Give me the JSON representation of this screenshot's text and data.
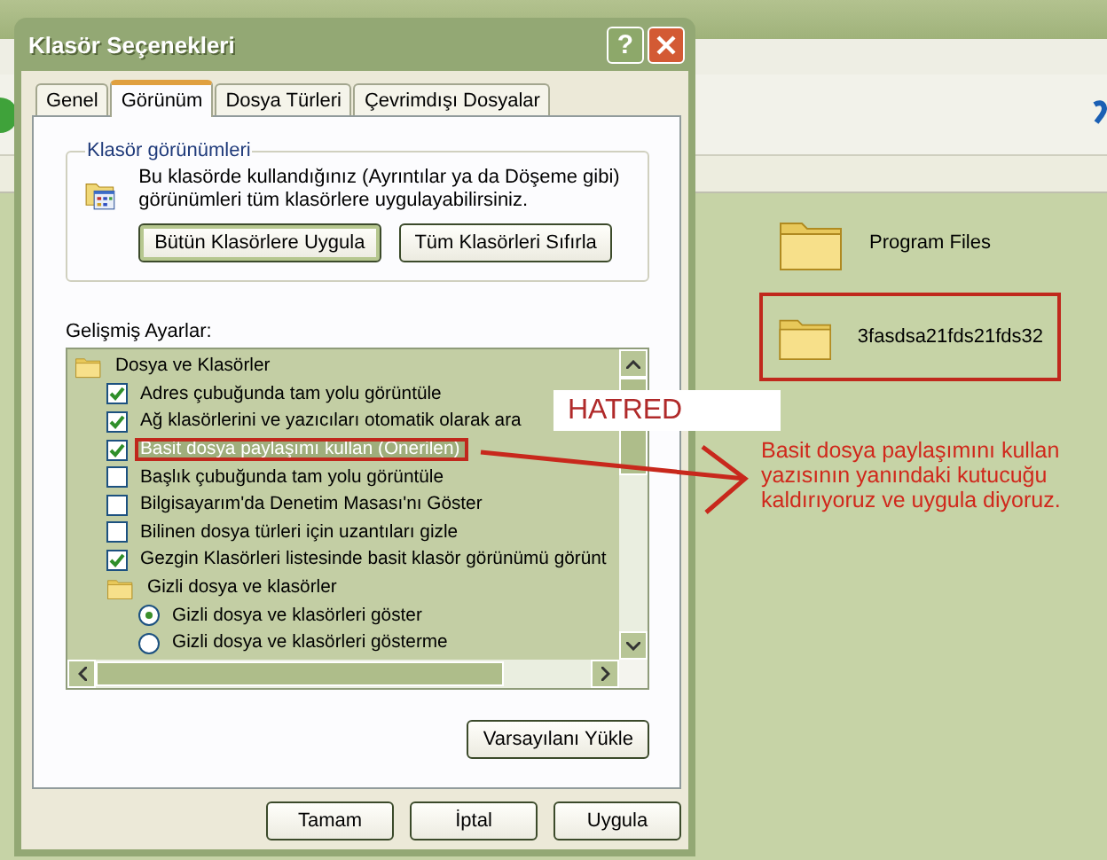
{
  "background_window": {
    "files": [
      {
        "name": "Program Files",
        "highlighted": false
      },
      {
        "name": "3fasdsa21fds21fds32",
        "highlighted": true
      }
    ]
  },
  "dialog": {
    "title": "Klasör Seçenekleri",
    "help": "?",
    "tabs": [
      {
        "label": "Genel",
        "selected": false
      },
      {
        "label": "Görünüm",
        "selected": true
      },
      {
        "label": "Dosya Türleri",
        "selected": false
      },
      {
        "label": "Çevrimdışı Dosyalar",
        "selected": false
      }
    ],
    "views_group": {
      "title": "Klasör görünümleri",
      "description": "Bu klasörde kullandığınız (Ayrıntılar ya da Döşeme gibi) görünümleri tüm klasörlere uygulayabilirsiniz.",
      "buttons": [
        "Bütün Klasörlere Uygula",
        "Tüm Klasörleri Sıfırla"
      ]
    },
    "advanced": {
      "label": "Gelişmiş Ayarlar:",
      "items": [
        {
          "kind": "folder",
          "label": "Dosya ve Klasörler",
          "selected": false,
          "highlighted": false,
          "children": [
            {
              "kind": "checkbox",
              "label": "Adres çubuğunda tam yolu görüntüle",
              "checked": true,
              "selected": false,
              "highlighted": false
            },
            {
              "kind": "checkbox",
              "label": "Ağ klasörlerini ve yazıcıları otomatik olarak ara",
              "checked": true,
              "selected": false,
              "highlighted": false
            },
            {
              "kind": "checkbox",
              "label": "Basit dosya paylaşımı kullan (Önerilen)",
              "checked": true,
              "selected": true,
              "highlighted": true
            },
            {
              "kind": "checkbox",
              "label": "Başlık çubuğunda tam yolu görüntüle",
              "checked": false,
              "selected": false,
              "highlighted": false
            },
            {
              "kind": "checkbox",
              "label": "Bilgisayarım'da Denetim Masası'nı Göster",
              "checked": false,
              "selected": false,
              "highlighted": false
            },
            {
              "kind": "checkbox",
              "label": "Bilinen dosya türleri için uzantıları gizle",
              "checked": false,
              "selected": false,
              "highlighted": false
            },
            {
              "kind": "checkbox",
              "label": "Gezgin Klasörleri listesinde basit klasör görünümü görünt",
              "checked": true,
              "selected": false,
              "highlighted": false
            },
            {
              "kind": "folder",
              "label": "Gizli dosya ve klasörler",
              "selected": false,
              "highlighted": false,
              "children": [
                {
                  "kind": "radio",
                  "label": "Gizli dosya ve klasörleri göster",
                  "checked": true,
                  "selected": false,
                  "highlighted": false
                },
                {
                  "kind": "radio",
                  "label": "Gizli dosya ve klasörleri gösterme",
                  "checked": false,
                  "selected": false,
                  "highlighted": false
                }
              ]
            }
          ]
        }
      ]
    },
    "restore_button": "Varsayılanı Yükle",
    "buttons": [
      "Tamam",
      "İptal",
      "Uygula"
    ]
  },
  "annotations": {
    "tag": "HATRED",
    "note_lines": [
      "Basit dosya paylaşımını kullan",
      "yazısının yanındaki kutucuğu",
      "kaldırıyoruz ve uygula diyoruz."
    ]
  }
}
